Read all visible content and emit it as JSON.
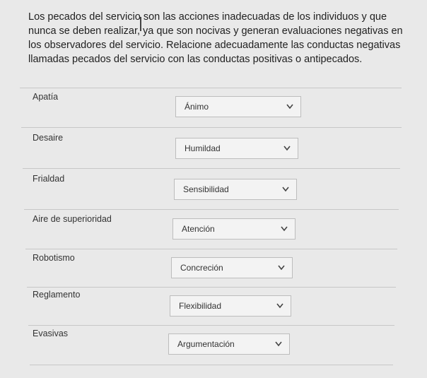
{
  "question": {
    "text": "Los pecados del servicio son las acciones inadecuadas de los individuos y que nunca se deben realizar, ya que son nocivas y generan evaluaciones negativas en los observadores del servicio. Relacione adecuadamente las conductas negativas llamadas pecados del servicio con las conductas positivas o antipecados."
  },
  "matching": {
    "rows": [
      {
        "label": "Apatía",
        "selected": "Ánimo"
      },
      {
        "label": "Desaire",
        "selected": "Humildad"
      },
      {
        "label": "Frialdad",
        "selected": "Sensibilidad"
      },
      {
        "label": "Aire de superioridad",
        "selected": "Atención"
      },
      {
        "label": "Robotismo",
        "selected": "Concreción"
      },
      {
        "label": "Reglamento",
        "selected": "Flexibilidad"
      },
      {
        "label": "Evasivas",
        "selected": "Argumentación"
      }
    ]
  },
  "icons": {
    "dropdown": "chevron-down-icon"
  }
}
